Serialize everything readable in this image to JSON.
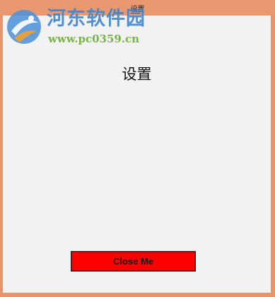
{
  "window": {
    "title": "设置"
  },
  "main": {
    "heading": "设置",
    "close_button_label": "Close Me"
  },
  "watermark": {
    "brand": "河东软件园",
    "url": "www.pc0359.cn",
    "logo_icon": "hedong-logo-icon"
  },
  "colors": {
    "frame": "#e8946b",
    "client_bg": "#f2f2f2",
    "button_bg": "#ff0000",
    "watermark_blue": "#3f86cf",
    "watermark_green": "#6cae35"
  }
}
